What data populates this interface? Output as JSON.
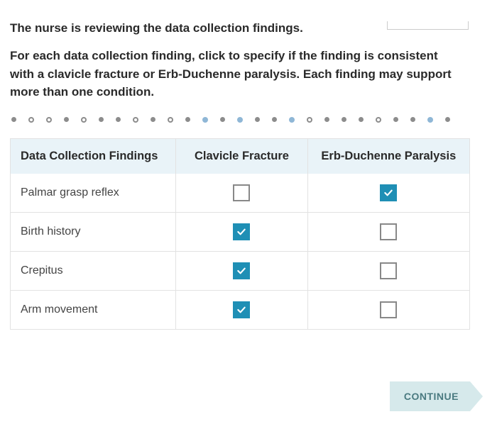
{
  "question": {
    "line1": "The nurse is reviewing the data collection findings.",
    "line2": "For each data collection finding, click to specify if the finding is consistent with a clavicle fracture or Erb-Duchenne paralysis. Each finding may support more than one condition."
  },
  "table": {
    "headers": {
      "findings": "Data Collection Findings",
      "clavicle": "Clavicle Fracture",
      "erb": "Erb-Duchenne Paralysis"
    },
    "rows": [
      {
        "finding": "Palmar grasp reflex",
        "clavicle": false,
        "erb": true
      },
      {
        "finding": "Birth history",
        "clavicle": true,
        "erb": false
      },
      {
        "finding": "Crepitus",
        "clavicle": true,
        "erb": false
      },
      {
        "finding": "Arm movement",
        "clavicle": true,
        "erb": false
      }
    ]
  },
  "continue_label": "CONTINUE"
}
